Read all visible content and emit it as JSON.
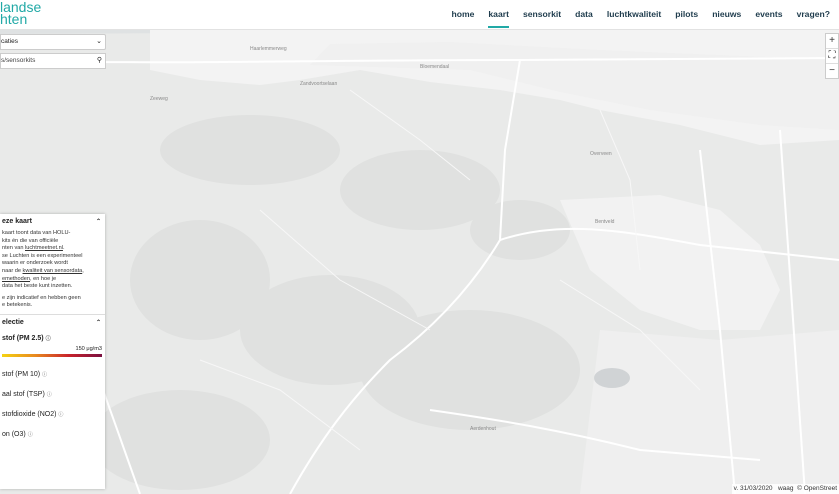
{
  "logo": {
    "line1": "landse",
    "line2": "hten"
  },
  "nav": {
    "items": [
      {
        "label": "home"
      },
      {
        "label": "kaart"
      },
      {
        "label": "sensorkit"
      },
      {
        "label": "data"
      },
      {
        "label": "luchtkwaliteit"
      },
      {
        "label": "pilots"
      },
      {
        "label": "nieuws"
      },
      {
        "label": "events"
      },
      {
        "label": "vragen?"
      }
    ],
    "active": "kaart"
  },
  "location_select": {
    "value": "caties"
  },
  "search": {
    "value": "s/sensorkits"
  },
  "zoom": {
    "in": "+",
    "fit": "⛶",
    "out": "−"
  },
  "about_panel": {
    "title": "eze kaart",
    "lines": [
      "kaart toont data van HOLU-",
      "kits én die van officiële",
      "nten van ",
      "se Luchten is een experimenteel",
      "waarin er onderzoek wordt",
      "naar de ",
      "emethoden",
      "data het beste kunt inzetten.",
      "e zijn indicatief en hebben geen",
      "e betekenis."
    ],
    "link_luchtmeetnet": "luchtmeetnet.nl",
    "link_kwaliteit": "kwaliteit van sensordata",
    "sep_comma": ",",
    "suffix_hoe": ", en hoe je"
  },
  "layer_panel": {
    "title": "electie",
    "layers": [
      "stof (PM 2.5)",
      "stof (PM 10)",
      "aal stof (TSP)",
      "stofdioxide (NO2)",
      "on (O3)"
    ],
    "scale_max": "150 μg/m3",
    "scale_min": "0"
  },
  "attribution": {
    "version": "v. 31/03/2020",
    "brand": "waag",
    "osm": "© OpenStreet"
  },
  "map_labels": [
    "Bloemendaal",
    "Haarlemmerweg",
    "Zandvoortselaan",
    "Overveen",
    "Zeeweg",
    "Bentveld",
    "Aerdenhout"
  ],
  "colors": {
    "accent": "#21a9a6",
    "nav_text": "#1f3c4d",
    "map_bg": "#e9eae9"
  }
}
